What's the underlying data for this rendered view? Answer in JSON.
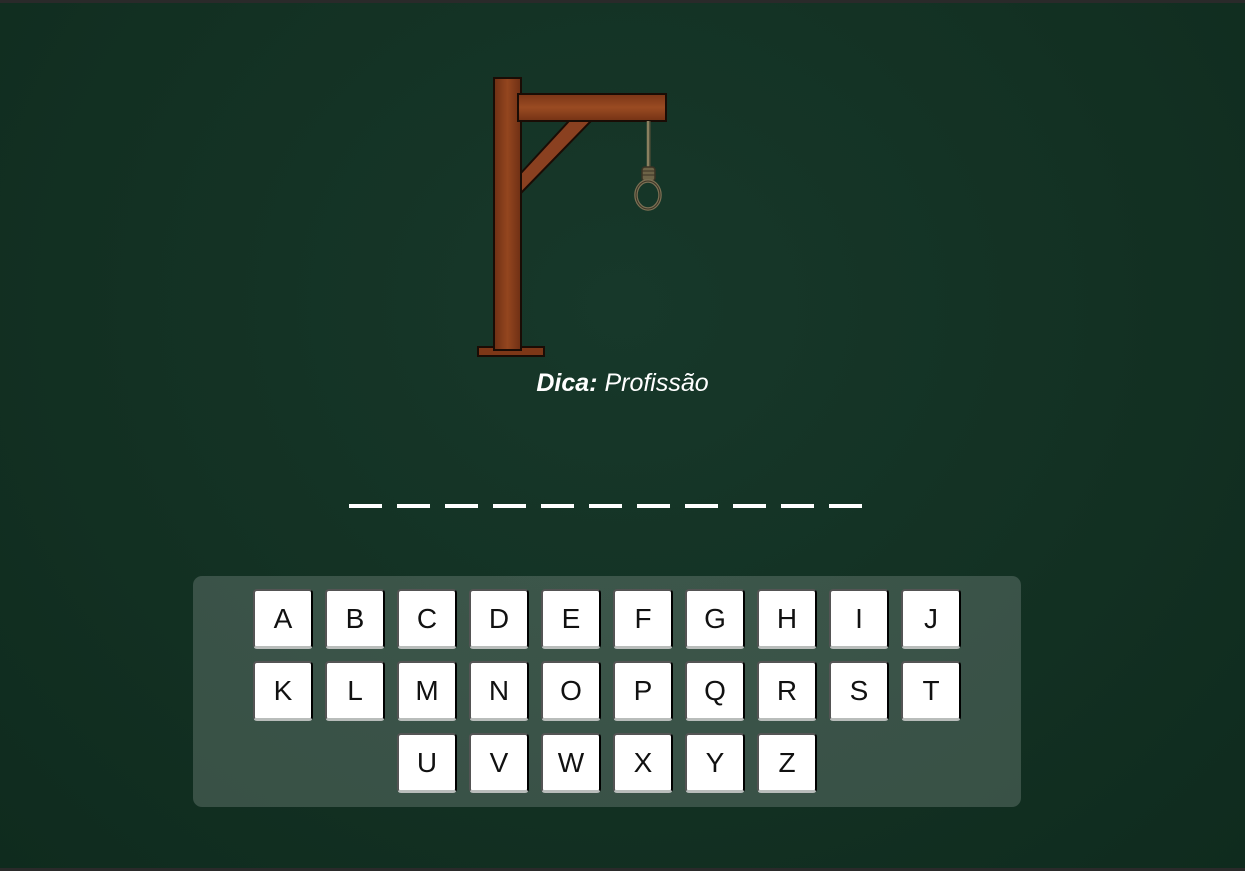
{
  "hint": {
    "label": "Dica:",
    "value": "Profissão"
  },
  "word": {
    "letters": [
      "",
      "",
      "",
      "",
      "",
      "",
      "",
      "",
      "",
      "",
      ""
    ]
  },
  "keyboard": {
    "rows": [
      [
        "A",
        "B",
        "C",
        "D",
        "E",
        "F",
        "G",
        "H",
        "I",
        "J"
      ],
      [
        "K",
        "L",
        "M",
        "N",
        "O",
        "P",
        "Q",
        "R",
        "S",
        "T"
      ],
      [
        "U",
        "V",
        "W",
        "X",
        "Y",
        "Z"
      ]
    ]
  },
  "colors": {
    "background": "#133123",
    "wood": "#8b3f1d",
    "key": "#ffffff"
  }
}
